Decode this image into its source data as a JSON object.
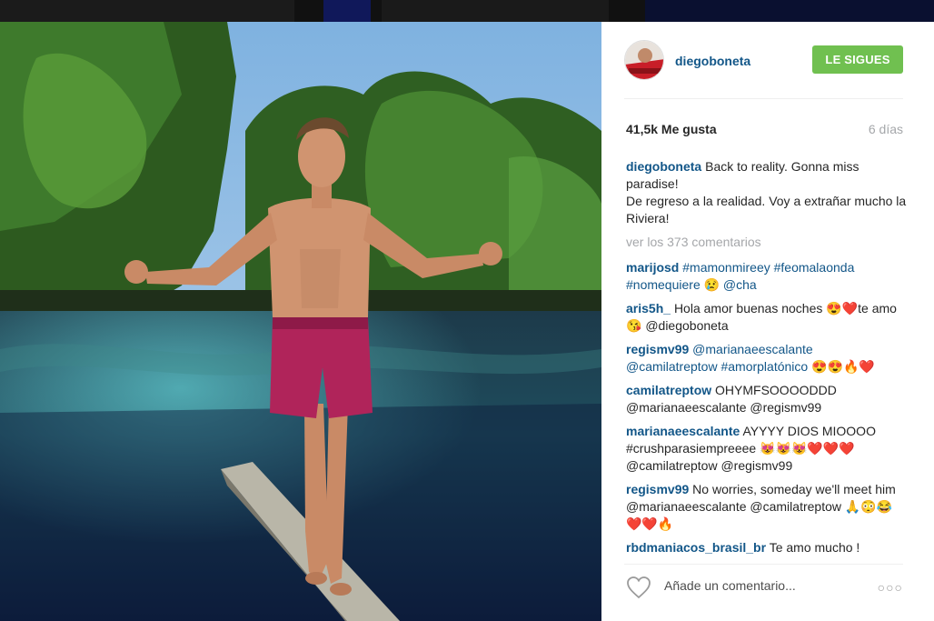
{
  "post": {
    "username": "diegoboneta",
    "follow_label": "LE SIGUES",
    "likes": "41,5k Me gusta",
    "time_ago": "6 días",
    "caption_user": "diegoboneta",
    "caption_line1": "Back to reality. Gonna miss paradise!",
    "caption_line2": "De regreso a la realidad. Voy a extrañar mucho la Riviera!",
    "view_comments": "ver los 373 comentarios",
    "add_comment_placeholder": "Añade un comentario...",
    "more_options": "○○○"
  },
  "comments": [
    {
      "user": "marijosd",
      "text": "#mamonmireey #feomalaonda #nomequiere 😢 @cha"
    },
    {
      "user": "aris5h_",
      "text": "Hola amor buenas noches 😍❤️te amo 😘 @diegoboneta"
    },
    {
      "user": "regismv99",
      "text": "@marianaeescalante @camilatreptow #amorplatónico 😍😍🔥❤️"
    },
    {
      "user": "camilatreptow",
      "text": "OHYMFSOOOODDD @marianaeescalante @regismv99"
    },
    {
      "user": "marianaeescalante",
      "text": "AYYYY DIOS MIOOOO #crushparasiempreeee 😻😻😻❤️❤️❤️ @camilatreptow @regismv99"
    },
    {
      "user": "regismv99",
      "text": "No worries, someday we'll meet him @marianaeescalante @camilatreptow 🙏😳😂❤️❤️🔥"
    },
    {
      "user": "rbdmaniacos_brasil_br",
      "text": "Te amo mucho !"
    }
  ],
  "colors": {
    "accent_link": "#125688",
    "follow_green": "#70c050",
    "muted": "#a5a7aa"
  }
}
